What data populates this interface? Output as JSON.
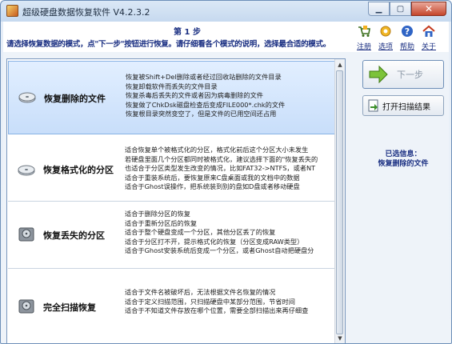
{
  "window": {
    "title": "超级硬盘数据恢复软件 V4.2.3.2"
  },
  "header": {
    "step": "第 1 步",
    "instruction": "请选择恢复数据的模式，点\"下一步\"按钮进行恢复。请仔细看各个模式的说明，选择最合适的模式。"
  },
  "toolbar": [
    {
      "label": "注册",
      "icon": "cart-icon"
    },
    {
      "label": "选项",
      "icon": "gear-icon"
    },
    {
      "label": "帮助",
      "icon": "help-icon"
    },
    {
      "label": "关于",
      "icon": "home-icon"
    }
  ],
  "modes": [
    {
      "name": "恢复删除的文件",
      "icon": "disk-icon",
      "selected": true,
      "desc": [
        "恢复被Shift+Del删除或者经过回收站删除的文件目录",
        "恢复卸载软件而丢失的文件目录",
        "恢复杀毒后丢失的文件或者因为病毒删除的文件",
        "恢复做了ChkDsk磁盘检查后变成FILE000*.chk的文件",
        "恢复根目录突然变空了，但是文件的已用空间还占用"
      ]
    },
    {
      "name": "恢复格式化的分区",
      "icon": "disk-icon",
      "selected": false,
      "desc": [
        "适合恢复单个被格式化的分区，格式化前后这个分区大小未发生",
        "若硬盘里面几个分区都同时被格式化，建议选择下面的\"恢复丢失的",
        "也适合于分区类型发生改变的情况，比如FAT32->NTFS，或者NT",
        "适合于重装系统后，要恢复原来C盘桌面或我的文档中的数据",
        "适合于Ghost误操作，把系统装到别的盘如D盘或者移动硬盘"
      ]
    },
    {
      "name": "恢复丢失的分区",
      "icon": "hdd-icon",
      "selected": false,
      "desc": [
        "适合于删除分区的恢复",
        "适合于重新分区后的恢复",
        "适合于整个硬盘变成一个分区，其他分区丢了的恢复",
        "适合于分区打不开，提示格式化的恢复（分区变成RAW类型）",
        "适合于Ghost安装系统后变成一个分区，或者Ghost自动把硬盘分"
      ]
    },
    {
      "name": "完全扫描恢复",
      "icon": "hdd-icon",
      "selected": false,
      "desc": [
        "适合于文件名被破坏后，无法根据文件名恢复的情况",
        "适合于定义扫描范围，只扫描硬盘中某部分范围，节省时间",
        "适合于不知道文件存放在哪个位置，需要全部扫描出来再仔细查"
      ]
    }
  ],
  "buttons": {
    "next": "下一步",
    "open_scan": "打开扫描结果"
  },
  "info": {
    "title": "已选信息：",
    "value": "恢复删除的文件"
  }
}
